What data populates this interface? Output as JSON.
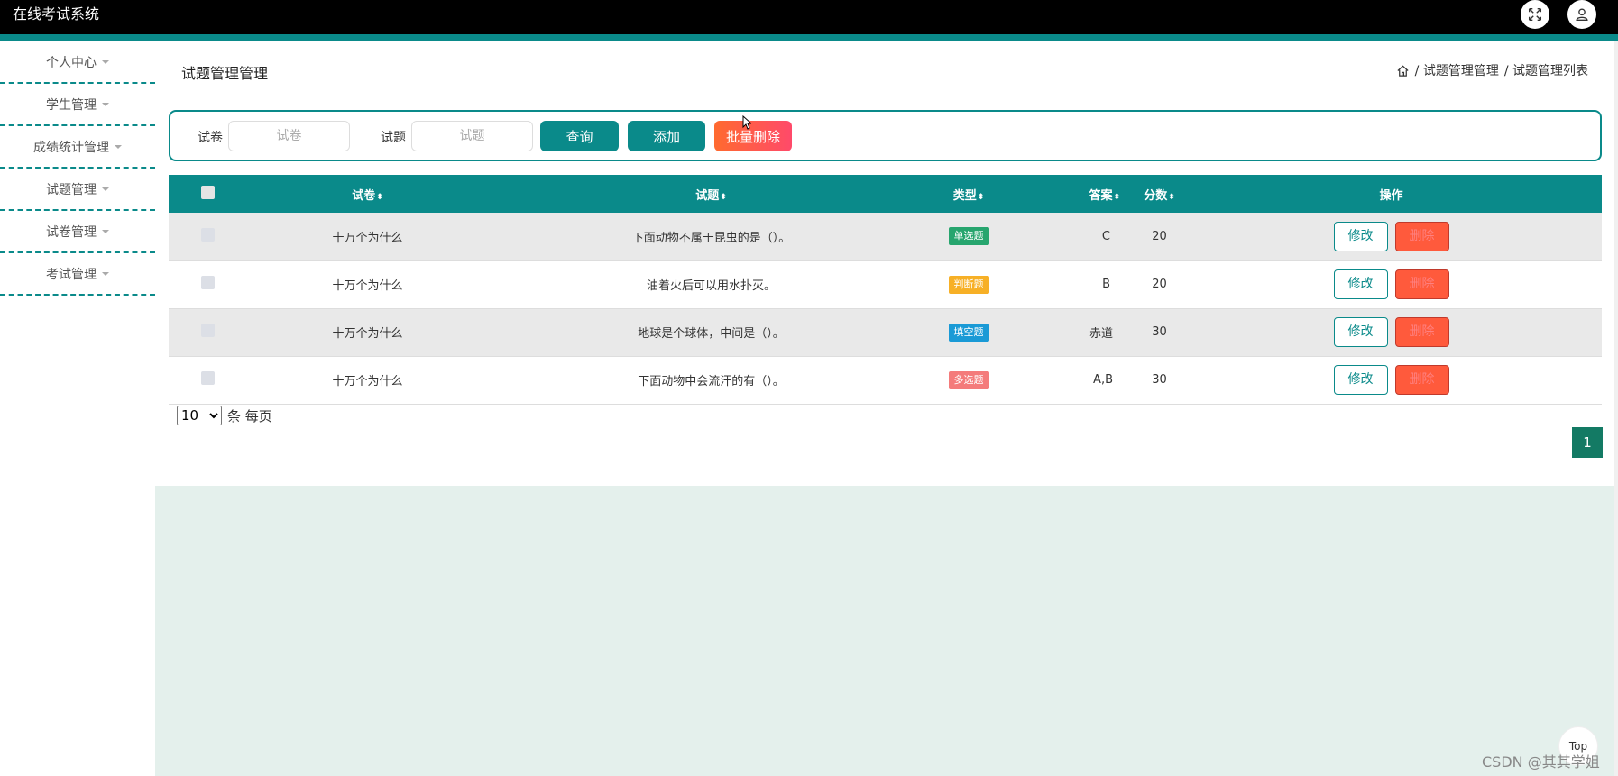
{
  "app": {
    "title": "在线考试系统"
  },
  "header_icons": [
    "fullscreen-icon",
    "user-icon"
  ],
  "sidebar": {
    "items": [
      {
        "label": "个人中心"
      },
      {
        "label": "学生管理"
      },
      {
        "label": "成绩统计管理"
      },
      {
        "label": "试题管理"
      },
      {
        "label": "试卷管理"
      },
      {
        "label": "考试管理"
      }
    ]
  },
  "page": {
    "title": "试题管理管理",
    "breadcrumb": [
      "/ 试题管理管理",
      "/ 试题管理列表"
    ]
  },
  "search": {
    "paper_label": "试卷",
    "paper_placeholder": "试卷",
    "question_label": "试题",
    "question_placeholder": "试题",
    "query_button": "查询",
    "add_button": "添加",
    "batch_delete_button": "批量删除"
  },
  "table": {
    "headers": [
      "试卷",
      "试题",
      "类型",
      "答案",
      "分数",
      "操作"
    ],
    "rows": [
      {
        "paper": "十万个为什么",
        "question": "下面动物不属于昆虫的是（）。",
        "type": "单选题",
        "answer": "C",
        "score": "20"
      },
      {
        "paper": "十万个为什么",
        "question": "油着火后可以用水扑灭。",
        "type": "判断题",
        "answer": "B",
        "score": "20"
      },
      {
        "paper": "十万个为什么",
        "question": "地球是个球体，中间是（）。",
        "type": "填空题",
        "answer": "赤道",
        "score": "30"
      },
      {
        "paper": "十万个为什么",
        "question": "下面动物中会流汗的有（）。",
        "type": "多选题",
        "answer": "A,B",
        "score": "30"
      }
    ],
    "edit_label": "修改",
    "delete_label": "删除"
  },
  "pagination": {
    "page_size": "10",
    "per_page_text": "条 每页",
    "current_page": "1"
  },
  "back_to_top": "Top",
  "watermark": "CSDN @其其学姐",
  "colors": {
    "accent": "#0a8a8a",
    "danger": "#ff5a3c",
    "page_active": "#137a64",
    "tag_single": "#27a56e",
    "tag_judge": "#f7b026",
    "tag_fill": "#1a9ad6",
    "tag_multi": "#f47b7b"
  }
}
